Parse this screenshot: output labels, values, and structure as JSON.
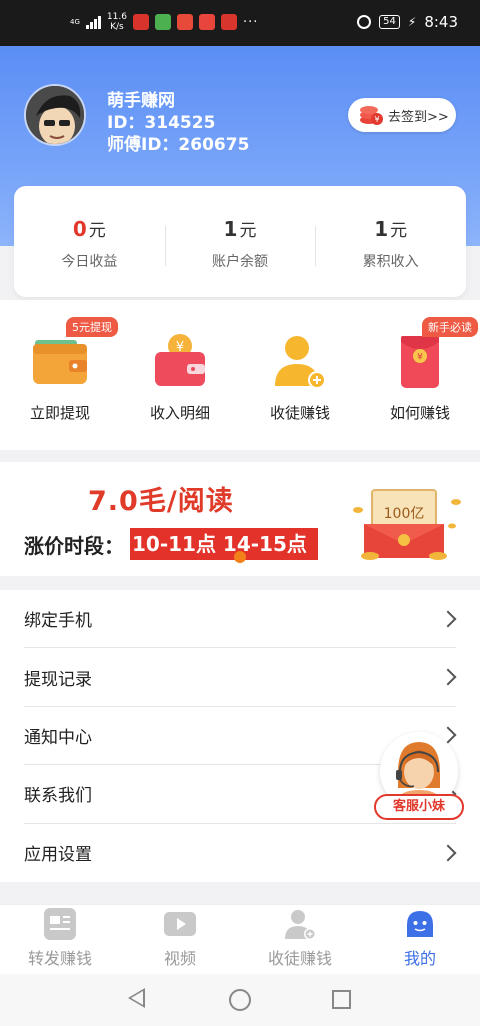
{
  "status_bar": {
    "network": "4G",
    "speed_value": "11.6",
    "speed_unit": "K/s",
    "more": "···",
    "battery": "54",
    "time": "8:43"
  },
  "profile": {
    "name": "萌手赚网",
    "id_line": "ID：314525",
    "master_line": "师傅ID：260675",
    "checkin_label": "去签到>>"
  },
  "stats": [
    {
      "value": "0",
      "unit": "元",
      "label": "今日收益",
      "color": "#e2382c"
    },
    {
      "value": "1",
      "unit": "元",
      "label": "账户余额",
      "color": "#333333"
    },
    {
      "value": "1",
      "unit": "元",
      "label": "累积收入",
      "color": "#333333"
    }
  ],
  "actions": [
    {
      "label": "立即提现",
      "badge": "5元提现",
      "icon": "wallet-icon"
    },
    {
      "label": "收入明细",
      "badge": "",
      "icon": "coin-wallet-icon"
    },
    {
      "label": "收徒赚钱",
      "badge": "",
      "icon": "add-user-icon"
    },
    {
      "label": "如何赚钱",
      "badge": "新手必读",
      "icon": "red-envelope-icon"
    }
  ],
  "banner": {
    "title": "7.0毛/阅读",
    "subtitle": "涨价时段：",
    "time_ranges": "10-11点 14-15点",
    "art_text": "100亿"
  },
  "menu": [
    {
      "label": "绑定手机"
    },
    {
      "label": "提现记录"
    },
    {
      "label": "通知中心"
    },
    {
      "label": "联系我们"
    },
    {
      "label": "应用设置"
    }
  ],
  "customer_service": {
    "label": "客服小妹"
  },
  "tabs": [
    {
      "label": "转发赚钱",
      "icon": "article-icon",
      "active": false
    },
    {
      "label": "视频",
      "icon": "video-icon",
      "active": false
    },
    {
      "label": "收徒赚钱",
      "icon": "user-add-icon",
      "active": false
    },
    {
      "label": "我的",
      "icon": "smiley-icon",
      "active": true
    }
  ],
  "colors": {
    "accent": "#3d6fe6",
    "header_gradient_top": "#5b8ef5",
    "highlight_red": "#e2382c",
    "inactive_gray": "#9a9a9a"
  }
}
